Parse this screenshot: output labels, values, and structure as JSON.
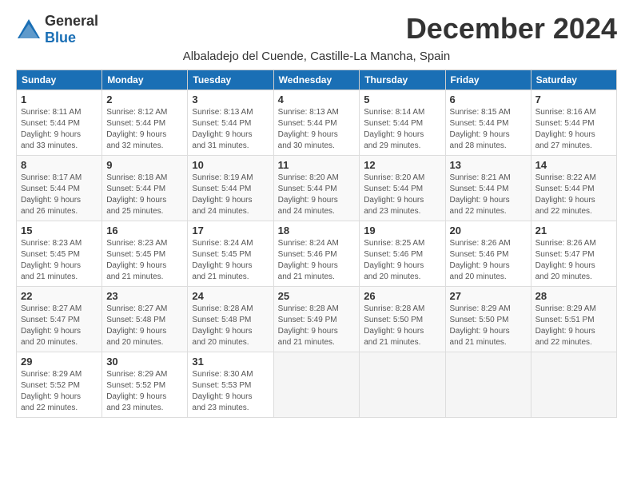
{
  "logo": {
    "general": "General",
    "blue": "Blue"
  },
  "title": "December 2024",
  "location": "Albaladejo del Cuende, Castille-La Mancha, Spain",
  "headers": [
    "Sunday",
    "Monday",
    "Tuesday",
    "Wednesday",
    "Thursday",
    "Friday",
    "Saturday"
  ],
  "weeks": [
    [
      {
        "day": "1",
        "info": "Sunrise: 8:11 AM\nSunset: 5:44 PM\nDaylight: 9 hours\nand 33 minutes."
      },
      {
        "day": "2",
        "info": "Sunrise: 8:12 AM\nSunset: 5:44 PM\nDaylight: 9 hours\nand 32 minutes."
      },
      {
        "day": "3",
        "info": "Sunrise: 8:13 AM\nSunset: 5:44 PM\nDaylight: 9 hours\nand 31 minutes."
      },
      {
        "day": "4",
        "info": "Sunrise: 8:13 AM\nSunset: 5:44 PM\nDaylight: 9 hours\nand 30 minutes."
      },
      {
        "day": "5",
        "info": "Sunrise: 8:14 AM\nSunset: 5:44 PM\nDaylight: 9 hours\nand 29 minutes."
      },
      {
        "day": "6",
        "info": "Sunrise: 8:15 AM\nSunset: 5:44 PM\nDaylight: 9 hours\nand 28 minutes."
      },
      {
        "day": "7",
        "info": "Sunrise: 8:16 AM\nSunset: 5:44 PM\nDaylight: 9 hours\nand 27 minutes."
      }
    ],
    [
      {
        "day": "8",
        "info": "Sunrise: 8:17 AM\nSunset: 5:44 PM\nDaylight: 9 hours\nand 26 minutes."
      },
      {
        "day": "9",
        "info": "Sunrise: 8:18 AM\nSunset: 5:44 PM\nDaylight: 9 hours\nand 25 minutes."
      },
      {
        "day": "10",
        "info": "Sunrise: 8:19 AM\nSunset: 5:44 PM\nDaylight: 9 hours\nand 24 minutes."
      },
      {
        "day": "11",
        "info": "Sunrise: 8:20 AM\nSunset: 5:44 PM\nDaylight: 9 hours\nand 24 minutes."
      },
      {
        "day": "12",
        "info": "Sunrise: 8:20 AM\nSunset: 5:44 PM\nDaylight: 9 hours\nand 23 minutes."
      },
      {
        "day": "13",
        "info": "Sunrise: 8:21 AM\nSunset: 5:44 PM\nDaylight: 9 hours\nand 22 minutes."
      },
      {
        "day": "14",
        "info": "Sunrise: 8:22 AM\nSunset: 5:44 PM\nDaylight: 9 hours\nand 22 minutes."
      }
    ],
    [
      {
        "day": "15",
        "info": "Sunrise: 8:23 AM\nSunset: 5:45 PM\nDaylight: 9 hours\nand 21 minutes."
      },
      {
        "day": "16",
        "info": "Sunrise: 8:23 AM\nSunset: 5:45 PM\nDaylight: 9 hours\nand 21 minutes."
      },
      {
        "day": "17",
        "info": "Sunrise: 8:24 AM\nSunset: 5:45 PM\nDaylight: 9 hours\nand 21 minutes."
      },
      {
        "day": "18",
        "info": "Sunrise: 8:24 AM\nSunset: 5:46 PM\nDaylight: 9 hours\nand 21 minutes."
      },
      {
        "day": "19",
        "info": "Sunrise: 8:25 AM\nSunset: 5:46 PM\nDaylight: 9 hours\nand 20 minutes."
      },
      {
        "day": "20",
        "info": "Sunrise: 8:26 AM\nSunset: 5:46 PM\nDaylight: 9 hours\nand 20 minutes."
      },
      {
        "day": "21",
        "info": "Sunrise: 8:26 AM\nSunset: 5:47 PM\nDaylight: 9 hours\nand 20 minutes."
      }
    ],
    [
      {
        "day": "22",
        "info": "Sunrise: 8:27 AM\nSunset: 5:47 PM\nDaylight: 9 hours\nand 20 minutes."
      },
      {
        "day": "23",
        "info": "Sunrise: 8:27 AM\nSunset: 5:48 PM\nDaylight: 9 hours\nand 20 minutes."
      },
      {
        "day": "24",
        "info": "Sunrise: 8:28 AM\nSunset: 5:48 PM\nDaylight: 9 hours\nand 20 minutes."
      },
      {
        "day": "25",
        "info": "Sunrise: 8:28 AM\nSunset: 5:49 PM\nDaylight: 9 hours\nand 21 minutes."
      },
      {
        "day": "26",
        "info": "Sunrise: 8:28 AM\nSunset: 5:50 PM\nDaylight: 9 hours\nand 21 minutes."
      },
      {
        "day": "27",
        "info": "Sunrise: 8:29 AM\nSunset: 5:50 PM\nDaylight: 9 hours\nand 21 minutes."
      },
      {
        "day": "28",
        "info": "Sunrise: 8:29 AM\nSunset: 5:51 PM\nDaylight: 9 hours\nand 22 minutes."
      }
    ],
    [
      {
        "day": "29",
        "info": "Sunrise: 8:29 AM\nSunset: 5:52 PM\nDaylight: 9 hours\nand 22 minutes."
      },
      {
        "day": "30",
        "info": "Sunrise: 8:29 AM\nSunset: 5:52 PM\nDaylight: 9 hours\nand 23 minutes."
      },
      {
        "day": "31",
        "info": "Sunrise: 8:30 AM\nSunset: 5:53 PM\nDaylight: 9 hours\nand 23 minutes."
      },
      null,
      null,
      null,
      null
    ]
  ]
}
